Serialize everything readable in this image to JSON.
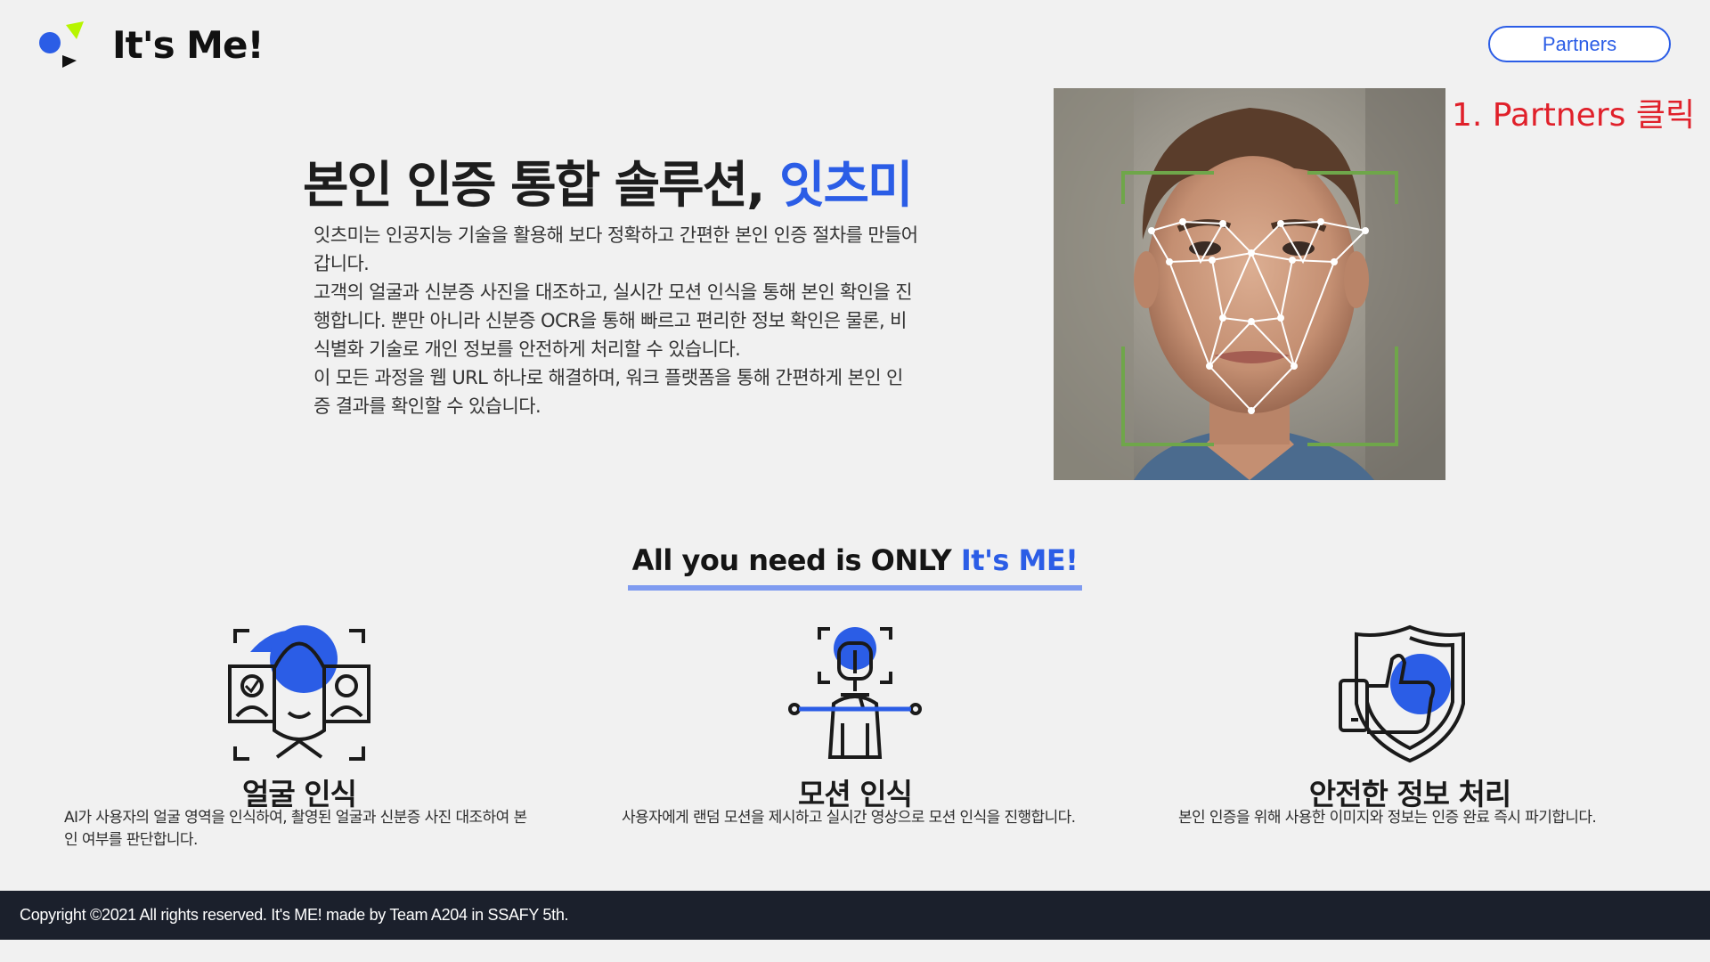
{
  "header": {
    "logo_text": "It's Me!",
    "partners_label": "Partners"
  },
  "annotation": "1. Partners 클릭",
  "hero": {
    "title_main": "본인 인증 통합 솔루션, ",
    "title_accent": "잇츠미",
    "description": [
      "잇츠미는 인공지능 기술을 활용해 보다 정확하고 간편한 본인 인증 절차를 만들어갑니다.",
      "고객의 얼굴과 신분증 사진을 대조하고, 실시간 모션 인식을 통해 본인 확인을 진행합니다. 뿐만 아니라 신분증 OCR을 통해 빠르고 편리한 정보 확인은 물론, 비식별화 기술로 개인 정보를 안전하게 처리할 수 있습니다.",
      "이 모든 과정을 웹 URL 하나로 해결하며, 워크 플랫폼을 통해 간편하게 본인 인증 결과를 확인할 수 있습니다."
    ]
  },
  "tagline": {
    "main": "All you need is ONLY ",
    "accent": "It's ME!"
  },
  "features": [
    {
      "title": "얼굴 인식",
      "description": "AI가 사용자의 얼굴 영역을 인식하여, 촬영된 얼굴과 신분증 사진 대조하여 본인 여부를 판단합니다.",
      "icon": "face-recognition-icon"
    },
    {
      "title": "모션 인식",
      "description": "사용자에게 랜덤 모션을 제시하고 실시간 영상으로 모션 인식을 진행합니다.",
      "icon": "motion-recognition-icon"
    },
    {
      "title": "안전한 정보 처리",
      "description": "본인 인증을 위해 사용한 이미지와 정보는 인증 완료 즉시 파기합니다.",
      "icon": "shield-thumbs-up-icon"
    }
  ],
  "footer": {
    "copyright": "Copyright ©2021 All rights reserved. It's ME! made by Team A204 in SSAFY 5th."
  },
  "colors": {
    "accent": "#2b5de6",
    "annotation": "#e0202a",
    "footer_bg": "#1b202c",
    "page_bg": "#f1f1f1"
  }
}
